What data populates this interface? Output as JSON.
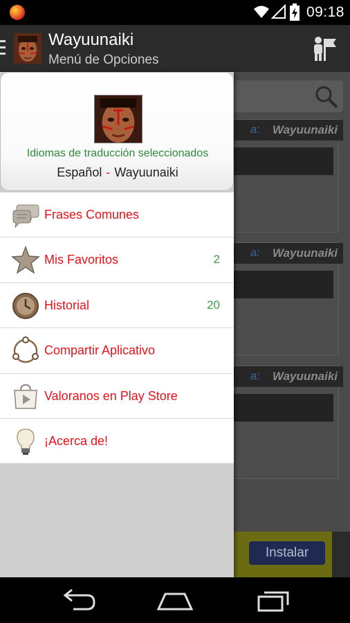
{
  "status_bar": {
    "time": "09:18",
    "icons": [
      "app-notification-icon",
      "wifi-icon",
      "signal-icon",
      "battery-charging-icon"
    ]
  },
  "action_bar": {
    "title": "Wayuunaiki",
    "subtitle": "Menú de Opciones",
    "right_icon": "language-selector-icon"
  },
  "drawer": {
    "header": {
      "langs_label": "Idiomas de traducción seleccionados",
      "source_lang": "Español",
      "separator": "-",
      "target_lang": "Wayuunaiki"
    },
    "items": [
      {
        "label": "Frases Comunes",
        "icon": "speech-bubbles-icon",
        "count": ""
      },
      {
        "label": "Mis Favoritos",
        "icon": "star-icon",
        "count": "2"
      },
      {
        "label": "Historial",
        "icon": "clock-icon",
        "count": "20"
      },
      {
        "label": "Compartir Aplicativo",
        "icon": "share-icon",
        "count": ""
      },
      {
        "label": "Valoranos en Play Store",
        "icon": "play-store-icon",
        "count": ""
      },
      {
        "label": "¡Acerca de!",
        "icon": "lightbulb-icon",
        "count": ""
      }
    ]
  },
  "background": {
    "cards": [
      {
        "to_label": "a:",
        "lang_name": "Wayuunaiki"
      },
      {
        "to_label": "a:",
        "lang_name": "Wayuunaiki"
      },
      {
        "to_label": "a:",
        "lang_name": "Wayuunaiki"
      }
    ],
    "ad": {
      "install_label": "Instalar"
    }
  },
  "colors": {
    "menu_text": "#e8121a",
    "count_text": "#3a9a4a",
    "langs_label": "#2b8a3a",
    "action_bar": "#2b2b2b"
  }
}
